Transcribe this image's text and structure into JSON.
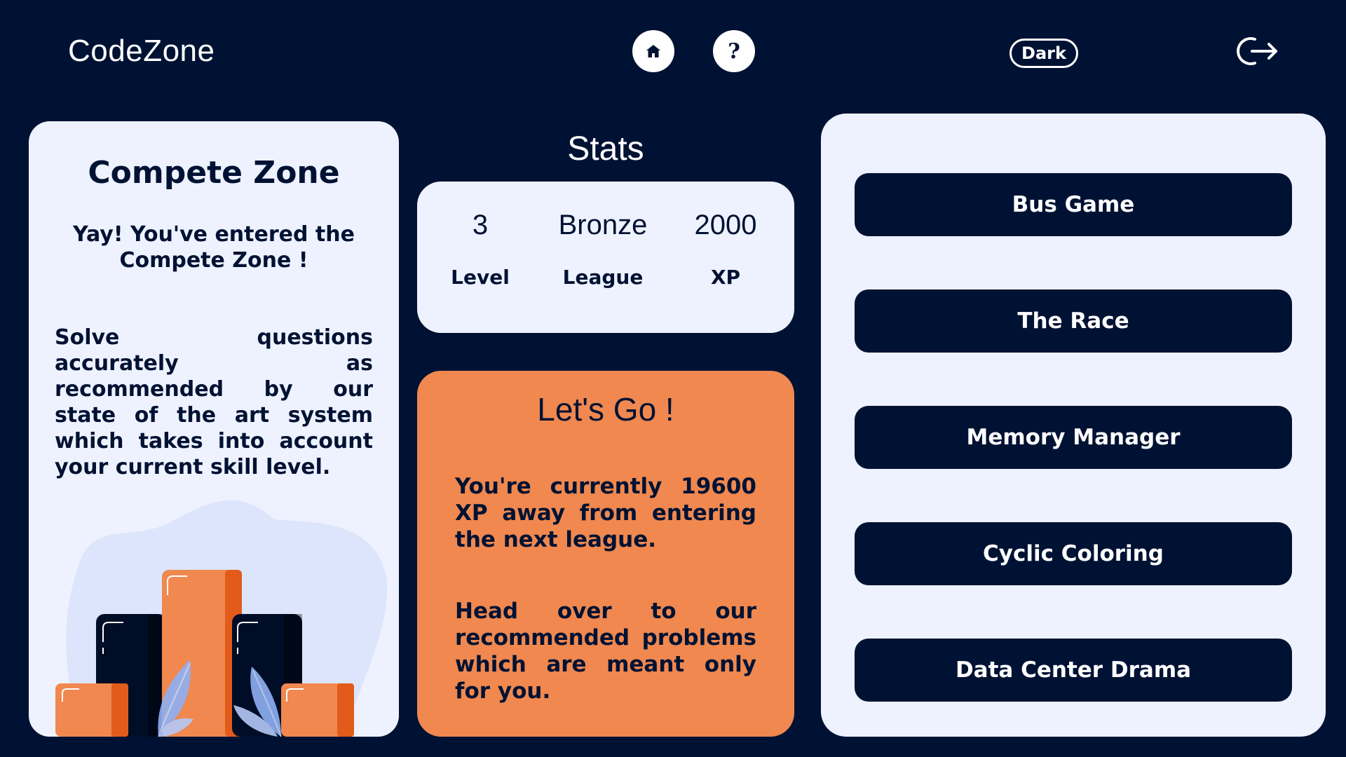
{
  "header": {
    "logo": "CodeZone",
    "help_label": "?",
    "theme_toggle_label": "Dark"
  },
  "compete": {
    "title": "Compete Zone",
    "subtitle": "Yay! You've entered the Compete Zone !",
    "description": "Solve questions accurately as recommended by our state of the art system which takes into account your current skill level."
  },
  "stats": {
    "heading": "Stats",
    "level_value": "3",
    "level_label": "Level",
    "league_value": "Bronze",
    "league_label": "League",
    "xp_value": "2000",
    "xp_label": "XP"
  },
  "go": {
    "title": "Let's Go !",
    "xp_message": "You're currently 19600 XP away from entering the next league.",
    "recommend_message": "Head over to our recommended problems which are meant only for you."
  },
  "games": [
    {
      "label": "Bus Game"
    },
    {
      "label": "The Race"
    },
    {
      "label": "Memory Manager"
    },
    {
      "label": "Cyclic Coloring"
    },
    {
      "label": "Data Center Drama"
    }
  ],
  "colors": {
    "background": "#001233",
    "panel": "#eef2ff",
    "accent_orange": "#f0884f",
    "dark_orange": "#e25b1a",
    "leaf_blue": "#8fb0f5"
  },
  "icons": [
    "home-icon",
    "help-icon",
    "logout-icon",
    "podium-illustration"
  ]
}
